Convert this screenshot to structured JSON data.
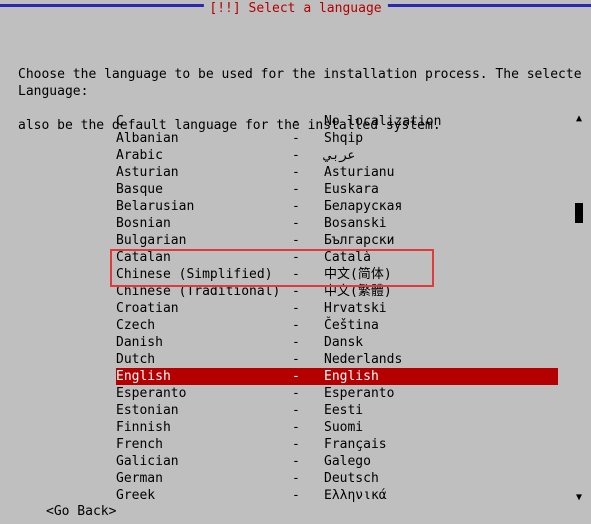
{
  "dialog": {
    "title": "[!!] Select a language",
    "instructions_line1": "Choose the language to be used for the installation process. The selecte",
    "instructions_line2": "also be the default language for the installed system.",
    "field_label": "Language:",
    "go_back": "<Go Back>"
  },
  "list": {
    "annotated_index": 8,
    "separator": "-",
    "items": [
      {
        "name": "C",
        "native": "No localization",
        "selected": false
      },
      {
        "name": "Albanian",
        "native": "Shqip",
        "selected": false
      },
      {
        "name": "Arabic",
        "native": "عربي",
        "selected": false
      },
      {
        "name": "Asturian",
        "native": "Asturianu",
        "selected": false
      },
      {
        "name": "Basque",
        "native": "Euskara",
        "selected": false
      },
      {
        "name": "Belarusian",
        "native": "Беларуская",
        "selected": false
      },
      {
        "name": "Bosnian",
        "native": "Bosanski",
        "selected": false
      },
      {
        "name": "Bulgarian",
        "native": "Български",
        "selected": false
      },
      {
        "name": "Catalan",
        "native": "Català",
        "selected": false
      },
      {
        "name": "Chinese (Simplified)",
        "native": "中文(简体)",
        "selected": false
      },
      {
        "name": "Chinese (Traditional)",
        "native": "中文(繁體)",
        "selected": false
      },
      {
        "name": "Croatian",
        "native": "Hrvatski",
        "selected": false
      },
      {
        "name": "Czech",
        "native": "Čeština",
        "selected": false
      },
      {
        "name": "Danish",
        "native": "Dansk",
        "selected": false
      },
      {
        "name": "Dutch",
        "native": "Nederlands",
        "selected": false
      },
      {
        "name": "English",
        "native": "English",
        "selected": true
      },
      {
        "name": "Esperanto",
        "native": "Esperanto",
        "selected": false
      },
      {
        "name": "Estonian",
        "native": "Eesti",
        "selected": false
      },
      {
        "name": "Finnish",
        "native": "Suomi",
        "selected": false
      },
      {
        "name": "French",
        "native": "Français",
        "selected": false
      },
      {
        "name": "Galician",
        "native": "Galego",
        "selected": false
      },
      {
        "name": "German",
        "native": "Deutsch",
        "selected": false
      },
      {
        "name": "Greek",
        "native": "Ελληνικά",
        "selected": false
      }
    ]
  }
}
